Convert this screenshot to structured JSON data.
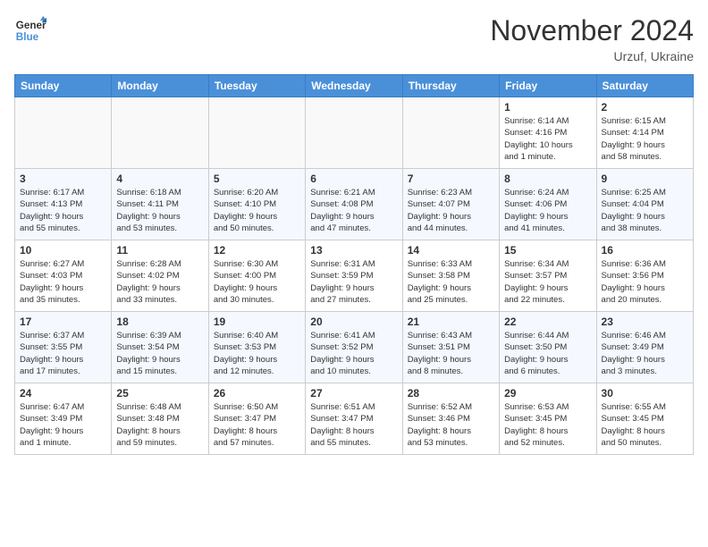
{
  "header": {
    "logo_line1": "General",
    "logo_line2": "Blue",
    "month": "November 2024",
    "location": "Urzuf, Ukraine"
  },
  "weekdays": [
    "Sunday",
    "Monday",
    "Tuesday",
    "Wednesday",
    "Thursday",
    "Friday",
    "Saturday"
  ],
  "weeks": [
    [
      {
        "day": "",
        "info": ""
      },
      {
        "day": "",
        "info": ""
      },
      {
        "day": "",
        "info": ""
      },
      {
        "day": "",
        "info": ""
      },
      {
        "day": "",
        "info": ""
      },
      {
        "day": "1",
        "info": "Sunrise: 6:14 AM\nSunset: 4:16 PM\nDaylight: 10 hours\nand 1 minute."
      },
      {
        "day": "2",
        "info": "Sunrise: 6:15 AM\nSunset: 4:14 PM\nDaylight: 9 hours\nand 58 minutes."
      }
    ],
    [
      {
        "day": "3",
        "info": "Sunrise: 6:17 AM\nSunset: 4:13 PM\nDaylight: 9 hours\nand 55 minutes."
      },
      {
        "day": "4",
        "info": "Sunrise: 6:18 AM\nSunset: 4:11 PM\nDaylight: 9 hours\nand 53 minutes."
      },
      {
        "day": "5",
        "info": "Sunrise: 6:20 AM\nSunset: 4:10 PM\nDaylight: 9 hours\nand 50 minutes."
      },
      {
        "day": "6",
        "info": "Sunrise: 6:21 AM\nSunset: 4:08 PM\nDaylight: 9 hours\nand 47 minutes."
      },
      {
        "day": "7",
        "info": "Sunrise: 6:23 AM\nSunset: 4:07 PM\nDaylight: 9 hours\nand 44 minutes."
      },
      {
        "day": "8",
        "info": "Sunrise: 6:24 AM\nSunset: 4:06 PM\nDaylight: 9 hours\nand 41 minutes."
      },
      {
        "day": "9",
        "info": "Sunrise: 6:25 AM\nSunset: 4:04 PM\nDaylight: 9 hours\nand 38 minutes."
      }
    ],
    [
      {
        "day": "10",
        "info": "Sunrise: 6:27 AM\nSunset: 4:03 PM\nDaylight: 9 hours\nand 35 minutes."
      },
      {
        "day": "11",
        "info": "Sunrise: 6:28 AM\nSunset: 4:02 PM\nDaylight: 9 hours\nand 33 minutes."
      },
      {
        "day": "12",
        "info": "Sunrise: 6:30 AM\nSunset: 4:00 PM\nDaylight: 9 hours\nand 30 minutes."
      },
      {
        "day": "13",
        "info": "Sunrise: 6:31 AM\nSunset: 3:59 PM\nDaylight: 9 hours\nand 27 minutes."
      },
      {
        "day": "14",
        "info": "Sunrise: 6:33 AM\nSunset: 3:58 PM\nDaylight: 9 hours\nand 25 minutes."
      },
      {
        "day": "15",
        "info": "Sunrise: 6:34 AM\nSunset: 3:57 PM\nDaylight: 9 hours\nand 22 minutes."
      },
      {
        "day": "16",
        "info": "Sunrise: 6:36 AM\nSunset: 3:56 PM\nDaylight: 9 hours\nand 20 minutes."
      }
    ],
    [
      {
        "day": "17",
        "info": "Sunrise: 6:37 AM\nSunset: 3:55 PM\nDaylight: 9 hours\nand 17 minutes."
      },
      {
        "day": "18",
        "info": "Sunrise: 6:39 AM\nSunset: 3:54 PM\nDaylight: 9 hours\nand 15 minutes."
      },
      {
        "day": "19",
        "info": "Sunrise: 6:40 AM\nSunset: 3:53 PM\nDaylight: 9 hours\nand 12 minutes."
      },
      {
        "day": "20",
        "info": "Sunrise: 6:41 AM\nSunset: 3:52 PM\nDaylight: 9 hours\nand 10 minutes."
      },
      {
        "day": "21",
        "info": "Sunrise: 6:43 AM\nSunset: 3:51 PM\nDaylight: 9 hours\nand 8 minutes."
      },
      {
        "day": "22",
        "info": "Sunrise: 6:44 AM\nSunset: 3:50 PM\nDaylight: 9 hours\nand 6 minutes."
      },
      {
        "day": "23",
        "info": "Sunrise: 6:46 AM\nSunset: 3:49 PM\nDaylight: 9 hours\nand 3 minutes."
      }
    ],
    [
      {
        "day": "24",
        "info": "Sunrise: 6:47 AM\nSunset: 3:49 PM\nDaylight: 9 hours\nand 1 minute."
      },
      {
        "day": "25",
        "info": "Sunrise: 6:48 AM\nSunset: 3:48 PM\nDaylight: 8 hours\nand 59 minutes."
      },
      {
        "day": "26",
        "info": "Sunrise: 6:50 AM\nSunset: 3:47 PM\nDaylight: 8 hours\nand 57 minutes."
      },
      {
        "day": "27",
        "info": "Sunrise: 6:51 AM\nSunset: 3:47 PM\nDaylight: 8 hours\nand 55 minutes."
      },
      {
        "day": "28",
        "info": "Sunrise: 6:52 AM\nSunset: 3:46 PM\nDaylight: 8 hours\nand 53 minutes."
      },
      {
        "day": "29",
        "info": "Sunrise: 6:53 AM\nSunset: 3:45 PM\nDaylight: 8 hours\nand 52 minutes."
      },
      {
        "day": "30",
        "info": "Sunrise: 6:55 AM\nSunset: 3:45 PM\nDaylight: 8 hours\nand 50 minutes."
      }
    ]
  ]
}
